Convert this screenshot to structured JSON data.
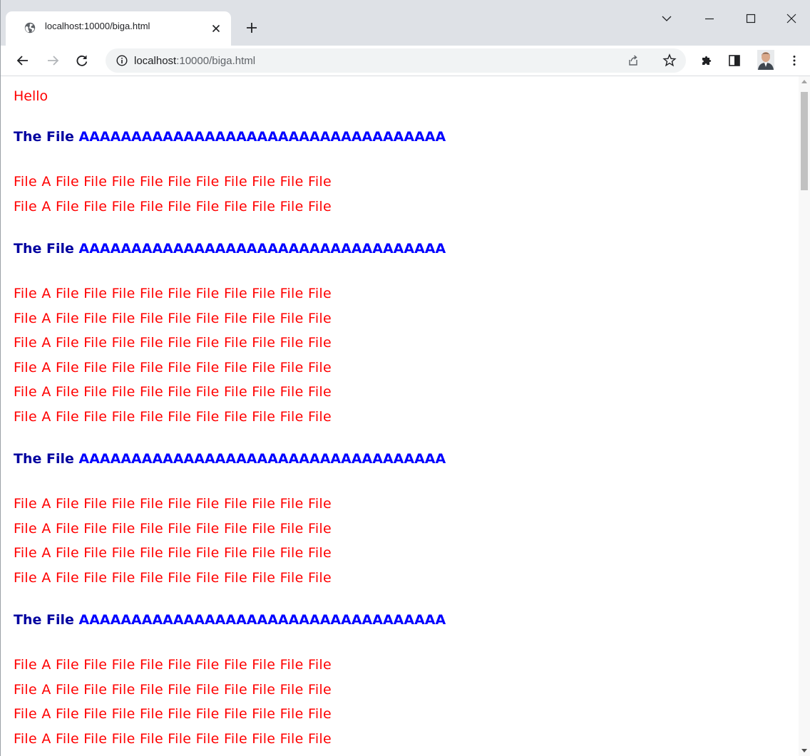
{
  "tab": {
    "title": "localhost:10000/biga.html",
    "favicon": "globe-icon",
    "close": "close-icon"
  },
  "window_controls": [
    "chevron-down-icon",
    "minimize-icon",
    "maximize-icon",
    "close-icon"
  ],
  "toolbar": {
    "back": "back-arrow-icon",
    "forward": "forward-arrow-icon",
    "reload": "reload-icon",
    "site_info": "info-icon",
    "url_host": "localhost",
    "url_path": ":10000/biga.html",
    "share": "share-icon",
    "bookmark": "star-icon",
    "extensions": "puzzle-icon",
    "side_panel": "side-panel-icon",
    "profile": "avatar",
    "menu": "kebab-menu-icon"
  },
  "page": {
    "hello": "Hello",
    "heading_prefix": "The File",
    "heading_suffix": "AAAAAAAAAAAAAAAAAAAAAAAAAAAAAAAAAAA",
    "file_line": "File A File File File File File File File File File File",
    "sections": [
      {
        "lines": 2
      },
      {
        "lines": 6
      },
      {
        "lines": 4
      },
      {
        "lines": 5
      }
    ]
  },
  "colors": {
    "text_red": "#ff0000",
    "heading_blue": "#0000ff",
    "heading_dark_blue": "#0000a0",
    "tab_strip": "#dee1e6",
    "omnibox": "#f1f3f4"
  }
}
